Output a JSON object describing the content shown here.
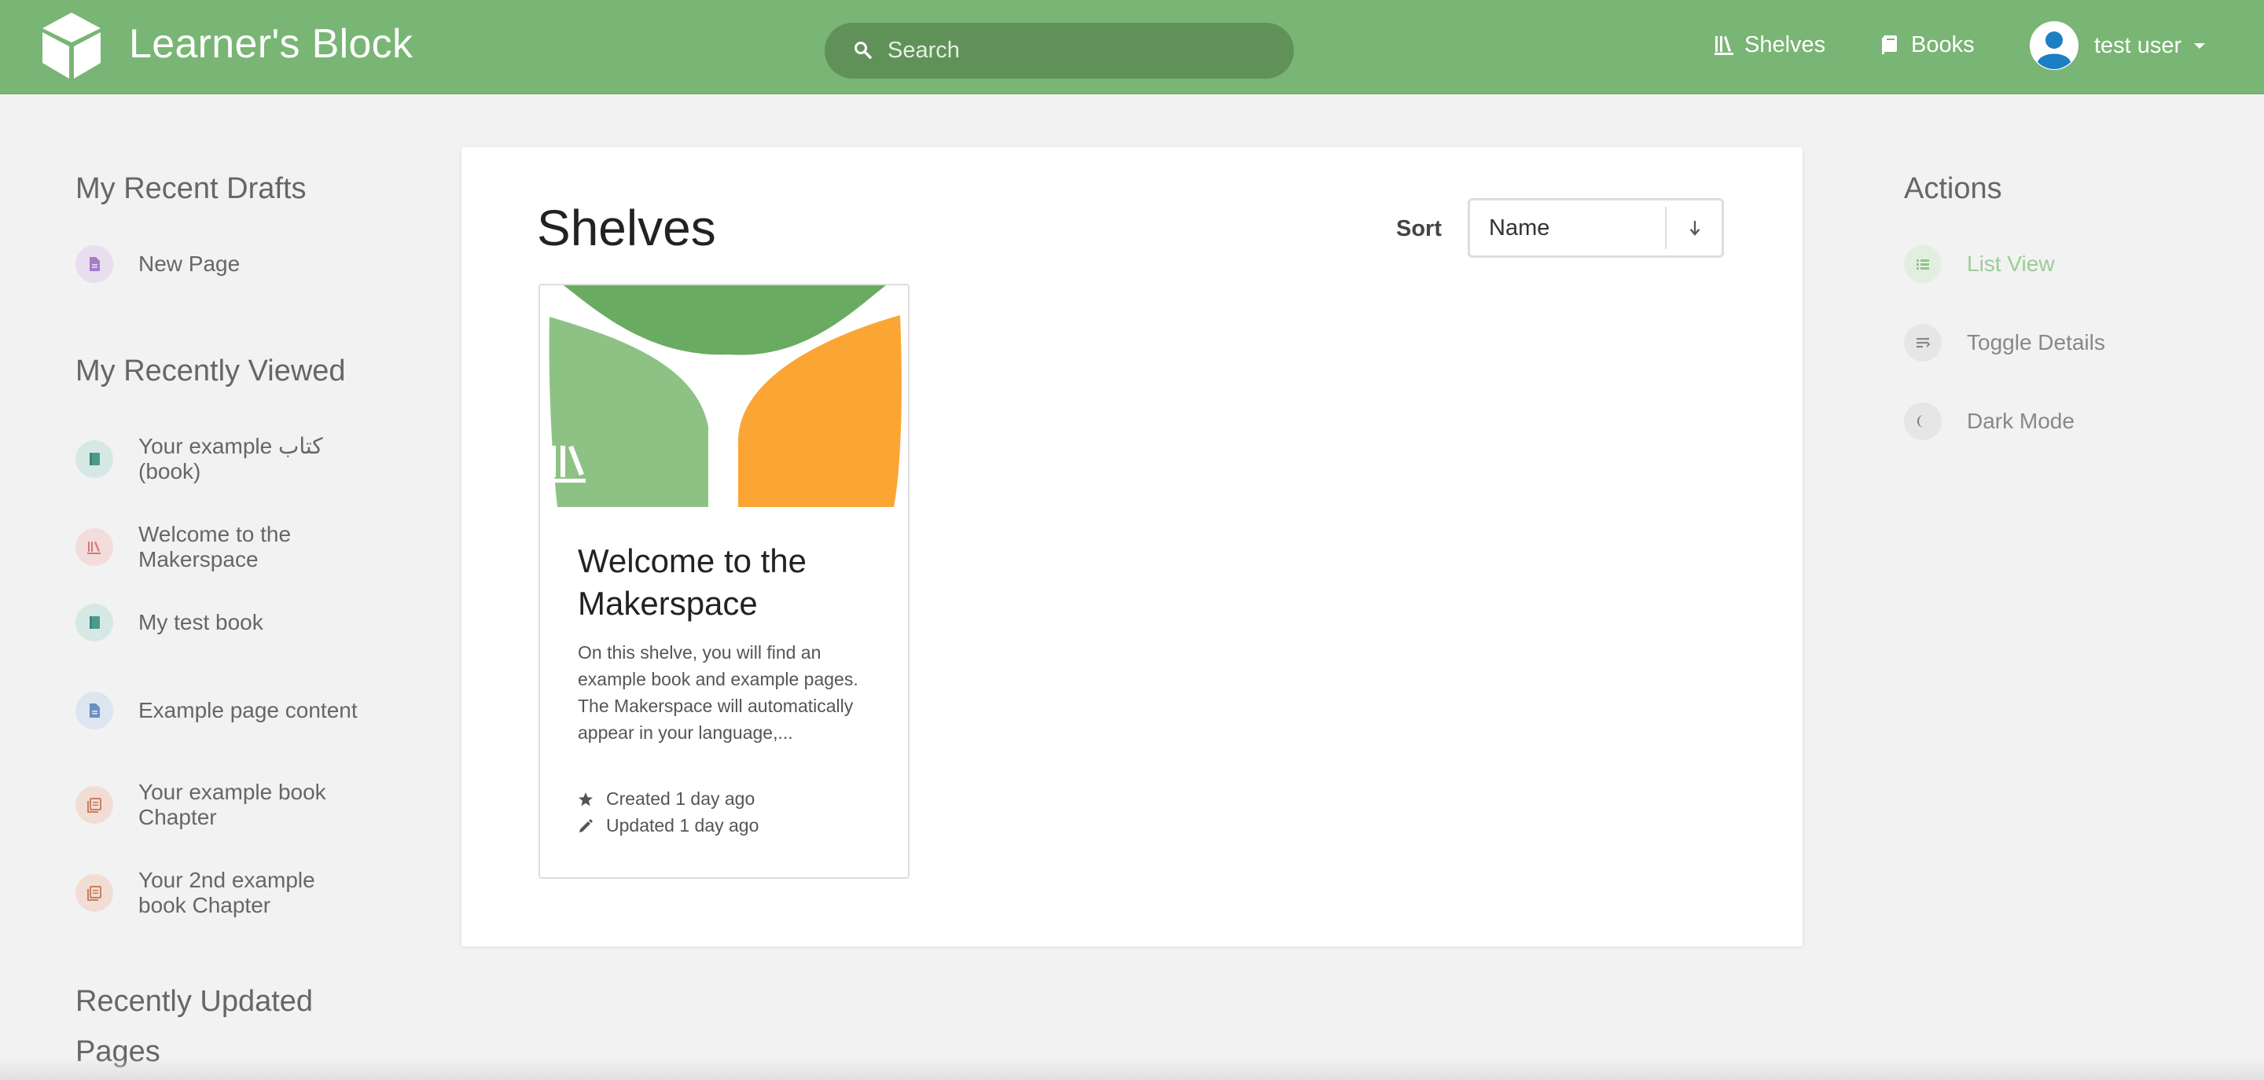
{
  "header": {
    "app_title": "Learner's Block",
    "search_placeholder": "Search",
    "nav": {
      "shelves": "Shelves",
      "books": "Books"
    },
    "user_name": "test user",
    "brand_color": "#79b574"
  },
  "left_sidebar": {
    "drafts_title": "My Recent Drafts",
    "drafts": [
      {
        "label": "New Page",
        "icon": "page-icon"
      }
    ],
    "viewed_title": "My Recently Viewed",
    "viewed": [
      {
        "label": "Your example كتاب (book)",
        "icon": "book-icon"
      },
      {
        "label": "Welcome to the Makerspace",
        "icon": "shelf-icon"
      },
      {
        "label": "My test book",
        "icon": "book-icon"
      },
      {
        "label": "Example page content",
        "icon": "page-icon"
      },
      {
        "label": "Your example book Chapter",
        "icon": "chapter-icon"
      },
      {
        "label": "Your 2nd example book Chapter",
        "icon": "chapter-icon"
      }
    ],
    "updated_title": "Recently Updated Pages"
  },
  "main": {
    "title": "Shelves",
    "sort_label": "Sort",
    "sort_value": "Name",
    "shelves": [
      {
        "name": "Welcome to the Makerspace",
        "description": "On this shelve, you will find an example book and example pages. The Makerspace will automatically appear in your language,...",
        "created": "Created 1 day ago",
        "updated": "Updated 1 day ago"
      }
    ]
  },
  "right_sidebar": {
    "title": "Actions",
    "actions": [
      {
        "label": "List View",
        "icon": "list-icon"
      },
      {
        "label": "Toggle Details",
        "icon": "details-icon"
      },
      {
        "label": "Dark Mode",
        "icon": "moon-icon"
      }
    ]
  }
}
